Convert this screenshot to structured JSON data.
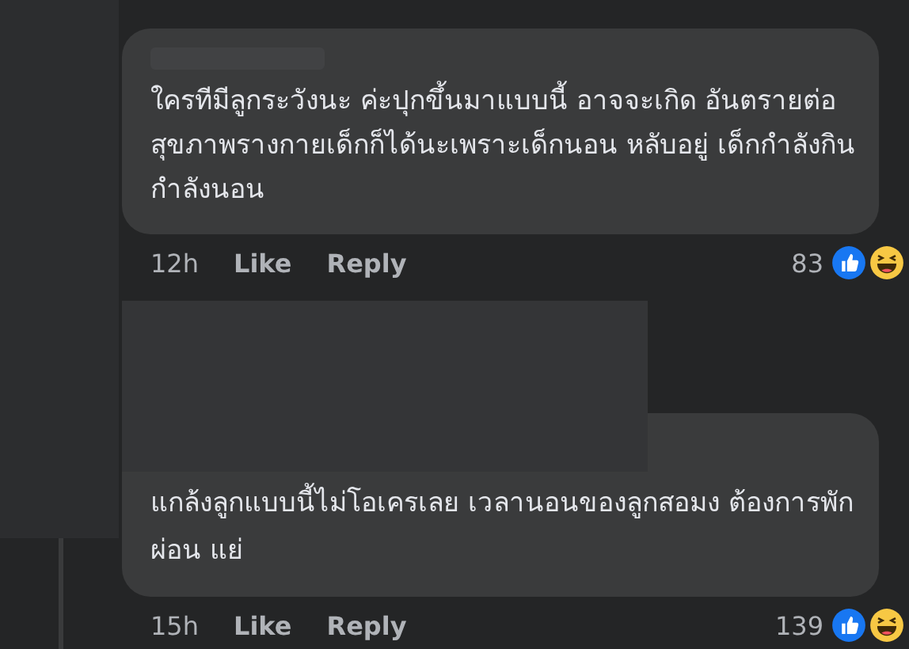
{
  "comments": [
    {
      "text": "ใครทีมีลูกระวังนะ ค่ะปุกขึ้นมาแบบนี้ อาจจะเกิด อันตรายต่อสุขภาพรางกายเด็กก็ได้นะเพราะเด็กนอน หลับอยู่ เด็กกำลังกินกำลังนอน",
      "time": "12h",
      "like": "Like",
      "reply": "Reply",
      "reaction_count": "83"
    },
    {
      "text": "แกล้งลูกแบบนี้ไม่โอเครเลย  เวลานอนของลูกสอมง ต้องการพักผ่อน  แย่",
      "time": "15h",
      "like": "Like",
      "reply": "Reply",
      "reaction_count": "139"
    }
  ]
}
